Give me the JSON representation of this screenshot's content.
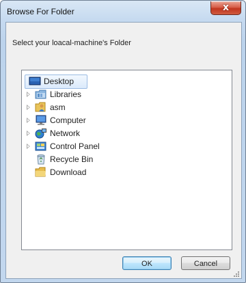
{
  "window": {
    "title": "Browse For Folder",
    "close_label": "x"
  },
  "description": "Select your loacal-machine's Folder",
  "tree": {
    "items": [
      {
        "label": "Desktop",
        "icon": "desktop-icon",
        "expandable": false,
        "selected": true
      },
      {
        "label": "Libraries",
        "icon": "libraries-icon",
        "expandable": true,
        "selected": false
      },
      {
        "label": "asm",
        "icon": "user-folder-icon",
        "expandable": true,
        "selected": false
      },
      {
        "label": "Computer",
        "icon": "computer-icon",
        "expandable": true,
        "selected": false
      },
      {
        "label": "Network",
        "icon": "network-icon",
        "expandable": true,
        "selected": false
      },
      {
        "label": "Control Panel",
        "icon": "control-panel-icon",
        "expandable": true,
        "selected": false
      },
      {
        "label": "Recycle Bin",
        "icon": "recycle-bin-icon",
        "expandable": false,
        "selected": false
      },
      {
        "label": "Download",
        "icon": "folder-icon",
        "expandable": false,
        "selected": false
      }
    ]
  },
  "buttons": {
    "ok": "OK",
    "cancel": "Cancel"
  },
  "colors": {
    "window_frame": "#c6daf0",
    "close_button": "#c1361f",
    "selection": "#dbeafb",
    "default_button_border": "#3c7fb1"
  }
}
